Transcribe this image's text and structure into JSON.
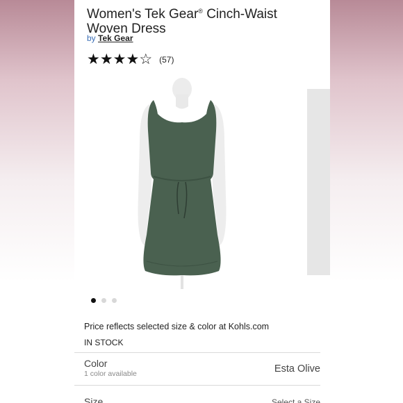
{
  "product": {
    "title_part1": "Women's Tek Gear",
    "title_reg": "®",
    "title_part2": " Cinch-Waist Woven Dress",
    "by_label": "by",
    "brand": "Tek Gear",
    "rating": 4,
    "rating_max": 5,
    "review_count": "(57)",
    "dress_color": "#4a6150"
  },
  "carousel": {
    "dots_total": 3,
    "active_index": 0
  },
  "info": {
    "price_note": "Price reflects selected size & color at Kohls.com",
    "stock_status": "IN STOCK"
  },
  "options": {
    "color": {
      "label": "Color",
      "sub": "1 color available",
      "value": "Esta Olive"
    },
    "size": {
      "label": "Size",
      "value": "Select a Size"
    }
  }
}
